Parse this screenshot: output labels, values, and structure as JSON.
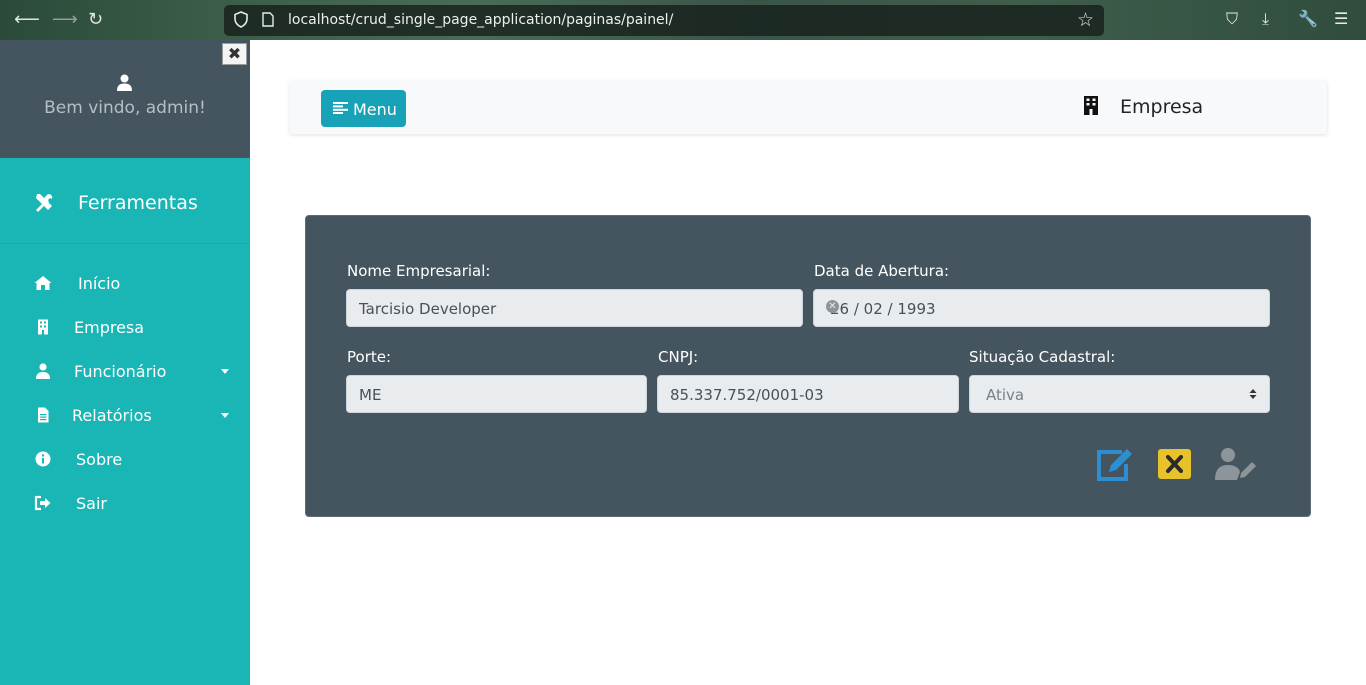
{
  "browser": {
    "url": "localhost/crud_single_page_application/paginas/painel/",
    "icons": [
      "back-arrow-icon",
      "forward-arrow-icon",
      "reload-icon",
      "shield-icon",
      "page-icon",
      "star-icon",
      "pocket-icon",
      "download-icon",
      "wrench-icon",
      "hamburger-icon"
    ]
  },
  "sidebar": {
    "close_label": "✖",
    "welcome": "Bem vindo, admin!",
    "section_title": "Ferramentas",
    "items": [
      {
        "label": "Início",
        "icon": "home-icon",
        "has_caret": false
      },
      {
        "label": "Empresa",
        "icon": "building-icon",
        "has_caret": false
      },
      {
        "label": "Funcionário",
        "icon": "user-icon",
        "has_caret": true
      },
      {
        "label": "Relatórios",
        "icon": "file-icon",
        "has_caret": true
      },
      {
        "label": "Sobre",
        "icon": "info-icon",
        "has_caret": false
      },
      {
        "label": "Sair",
        "icon": "sign-out-icon",
        "has_caret": false
      }
    ]
  },
  "topbar": {
    "menu_label": "Menu",
    "page_title": "Empresa"
  },
  "form": {
    "nome_label": "Nome Empresarial:",
    "nome_value": "Tarcisio Developer",
    "data_label": "Data de Abertura:",
    "data_value": "26 / 02 / 1993",
    "porte_label": "Porte:",
    "porte_value": "ME",
    "cnpj_label": "CNPJ:",
    "cnpj_value": "85.337.752/0001-03",
    "situacao_label": "Situação Cadastral:",
    "situacao_value": "Ativa"
  },
  "actions": [
    "edit-icon",
    "cancel-icon",
    "user-edit-icon"
  ],
  "colors": {
    "sidebar": "#1ab5b5",
    "sidebar_head": "#45555f",
    "card": "#45555f",
    "menu_button": "#17a2b8",
    "edit": "#2d8fd1",
    "cancel": "#e7c22a",
    "user_edit": "#8d949a"
  }
}
